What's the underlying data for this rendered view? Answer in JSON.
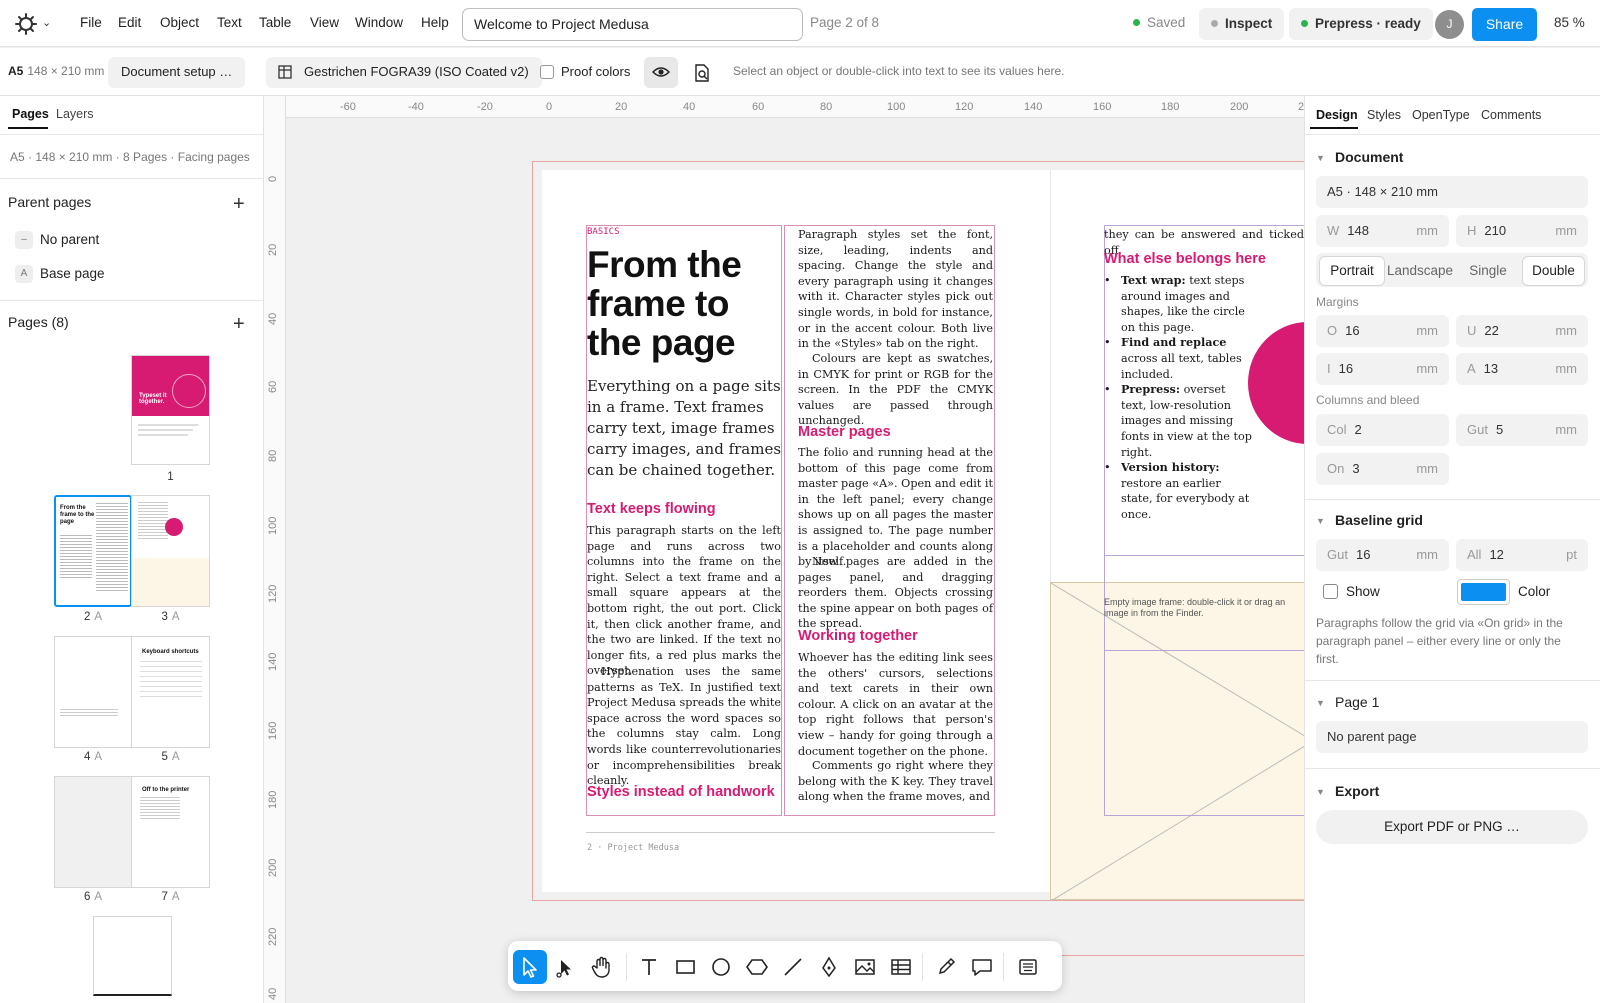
{
  "app": {
    "title": "Welcome to Project Medusa",
    "page_indicator": "Page 2 of 8",
    "saved": "Saved",
    "inspect": "Inspect",
    "prepress": "Prepress · ready",
    "avatar": "J",
    "share": "Share",
    "zoom": "85 %"
  },
  "menu": [
    "File",
    "Edit",
    "Object",
    "Text",
    "Table",
    "View",
    "Window",
    "Help"
  ],
  "toolbar": {
    "format": "A5",
    "format_size": "148 × 210 mm",
    "document_setup": "Document setup …",
    "color_profile": "Gestrichen FOGRA39 (ISO Coated v2)",
    "proof_colors": "Proof colors",
    "hint": "Select an object or double-click into text to see its values here."
  },
  "left_panel": {
    "tabs": [
      "Pages",
      "Layers"
    ],
    "info": "A5 · 148 × 210 mm · 8 Pages · Facing pages",
    "parent_pages_title": "Parent pages",
    "parent_pages": [
      {
        "badge": "–",
        "label": "No parent"
      },
      {
        "badge": "A",
        "label": "Base page"
      }
    ],
    "pages_title": "Pages (8)",
    "thumb1_title": "Typeset it together.",
    "thumb2_title": "From the frame to the page",
    "thumb5_title": "Keyboard shortcuts",
    "thumb7_title": "Off to the printer",
    "page_labels": [
      {
        "num": "1",
        "parent": ""
      },
      {
        "num": "2",
        "parent": "A"
      },
      {
        "num": "3",
        "parent": "A"
      },
      {
        "num": "4",
        "parent": "A"
      },
      {
        "num": "5",
        "parent": "A"
      },
      {
        "num": "6",
        "parent": "A"
      },
      {
        "num": "7",
        "parent": "A"
      }
    ]
  },
  "ruler": {
    "top": [
      "-60",
      "-40",
      "-20",
      "0",
      "20",
      "40",
      "60",
      "80",
      "100",
      "120",
      "140",
      "160",
      "180",
      "200",
      "2"
    ],
    "left": [
      "0",
      "20",
      "40",
      "60",
      "80",
      "100",
      "120",
      "140",
      "160",
      "180",
      "200",
      "220",
      "40"
    ]
  },
  "canvas": {
    "kicker": "BASICS",
    "headline": "From the frame to the page",
    "lede": "Everything on a page sits in a frame. Text frames carry text, image frames carry images, and frames can be chained together.",
    "h_text_keeps_flowing": "Text keeps flowing",
    "p1": "This paragraph starts on the left page and runs across two columns into the frame on the right. Select a text frame and a small square appears at the bottom right, the out port. Click it, then click another frame, and the two are linked. If the text no longer fits, a red plus marks the overset.",
    "p2": "Hyphenation uses the same patterns as TeX. In justified text Project Medusa spreads the white space across the word spaces so the columns stay calm. Long words like counterrevolutionaries or incomprehensibilities break cleanly.",
    "h_styles": "Styles instead of handwork",
    "p3": "Paragraph styles set the font, size, leading, indents and spacing. Change the style and every paragraph using it changes with it. Character styles pick out single words, in bold for instance, or in the accent colour. Both live in the «Styles» tab on the right.",
    "p4": "Colours are kept as swatches, in CMYK for print or RGB for the screen. In the PDF the CMYK values are passed through unchanged.",
    "h_master": "Master pages",
    "p5": "The folio and running head at the bottom of this page come from master page «A». Open and edit it in the left panel; every change shows up on all pages the master is assigned to. The page number is a placeholder and counts along by itself.",
    "p6": "New pages are added in the pages panel, and dragging reorders them. Objects crossing the spine appear on both pages of the spread.",
    "h_working": "Working together",
    "p7": "Whoever has the editing link sees the others' cursors, selections and text carets in their own colour. A click on an avatar at the top right follows that person's view – handy for going through a document together on the phone.",
    "p8": "Comments go right where they belong with the K key. They travel along when the frame moves, and",
    "r_top": "they can be answered and ticked off.",
    "h_what_else": "What else belongs here",
    "bullets": [
      {
        "b": "Text wrap:",
        "t": "text steps around images and shapes, like the circle on this page."
      },
      {
        "b": "Find and replace",
        "t": "across all text, tables included."
      },
      {
        "b": "Prepress:",
        "t": "overset text, low-resolution images and missing fonts in view at the top right."
      },
      {
        "b": "Version history:",
        "t": "restore an earlier state, for everybody at once."
      }
    ],
    "img_hint": "Empty image frame: double-click it or drag an image in from the Finder.",
    "folio": "2  ·  Project Medusa"
  },
  "tools": [
    "select-tool",
    "direct-select-tool",
    "hand-tool",
    "text-tool",
    "rectangle-tool",
    "ellipse-tool",
    "polygon-tool",
    "line-tool",
    "pen-tool",
    "image-frame-tool",
    "table-tool",
    "eyedropper-tool",
    "comment-tool",
    "keyboard-tool"
  ],
  "right_panel": {
    "tabs": [
      "Design",
      "Styles",
      "OpenType",
      "Comments"
    ],
    "document": {
      "title": "Document",
      "format": "A5 · 148 × 210 mm",
      "w_label": "W",
      "w": "148",
      "h_label": "H",
      "h": "210",
      "unit": "mm",
      "orientation": [
        "Portrait",
        "Landscape"
      ],
      "orientation_selected": "Portrait",
      "pages_mode": [
        "Single",
        "Double"
      ],
      "pages_mode_selected": "Double",
      "margins_label": "Margins",
      "margins": [
        {
          "l": "O",
          "v": "16"
        },
        {
          "l": "U",
          "v": "22"
        },
        {
          "l": "I",
          "v": "16"
        },
        {
          "l": "A",
          "v": "13"
        }
      ],
      "columns_label": "Columns and bleed",
      "col_label": "Col",
      "col": "2",
      "gut_label": "Gut",
      "gut": "5",
      "on_label": "On",
      "on": "3"
    },
    "baseline": {
      "title": "Baseline grid",
      "gut_label": "Gut",
      "gut": "16",
      "unit1": "mm",
      "all_label": "All",
      "all": "12",
      "unit2": "pt",
      "show": "Show",
      "color": "Color",
      "note": "Paragraphs follow the grid via «On grid» in the paragraph panel – either every line or only the first.",
      "color_value": "#0b8ff0"
    },
    "page1": {
      "title": "Page 1",
      "parent": "No parent page"
    },
    "export": {
      "title": "Export",
      "button": "Export PDF or PNG …"
    }
  },
  "colors": {
    "accent": "#0b8ff0",
    "brand_pink": "#d81b72",
    "status_green": "#2bb24c"
  }
}
